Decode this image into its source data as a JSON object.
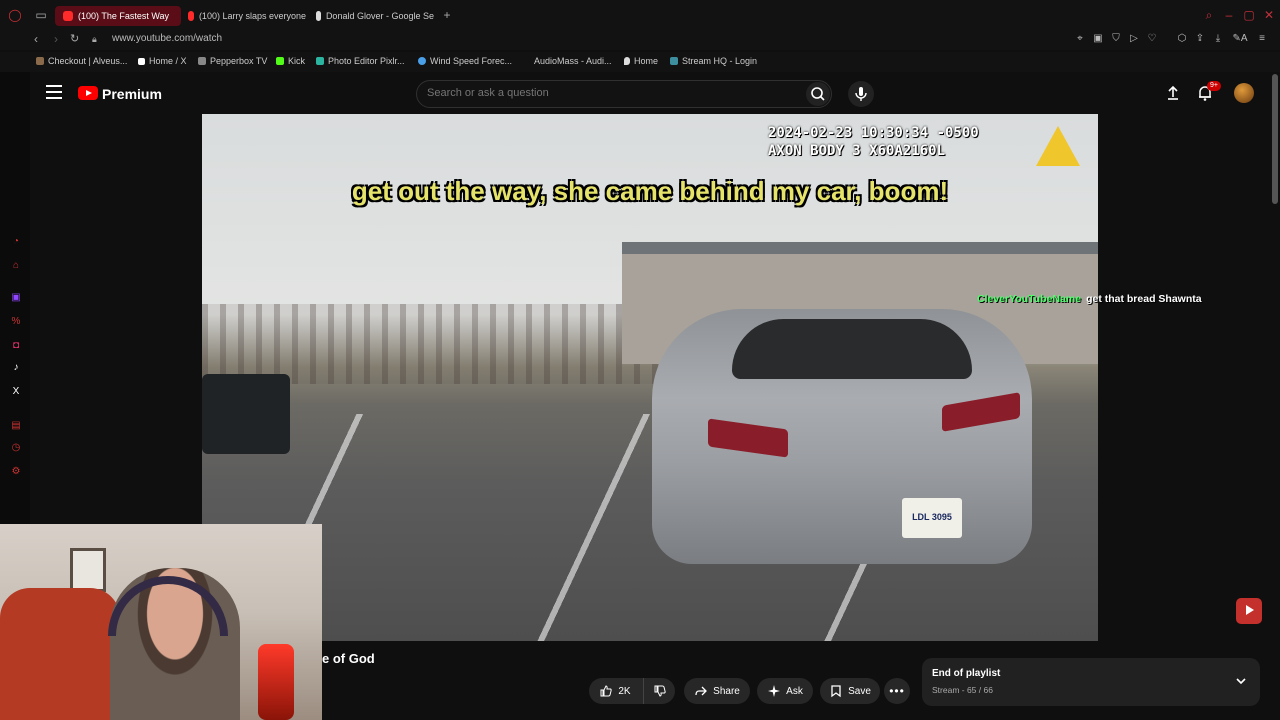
{
  "browser": {
    "tabs": [
      {
        "label": "(100) The Fastest Way",
        "active": true
      },
      {
        "label": "(100) Larry slaps everyone",
        "active": false
      },
      {
        "label": "Donald Glover - Google Se",
        "active": false
      }
    ],
    "url": "www.youtube.com/watch",
    "bookmarks": [
      "Checkout | Alveus...",
      "Home / X",
      "Pepperbox TV",
      "Kick",
      "Photo Editor Pixlr...",
      "Wind Speed Forec...",
      "AudioMass - Audi...",
      "Home",
      "Stream HQ - Login"
    ]
  },
  "youtube": {
    "brand": "Premium",
    "search_placeholder": "Search or ask a question",
    "notification_count": "9+"
  },
  "video": {
    "timestamp_line1": "2024-02-23 10:30:34 -0500",
    "timestamp_line2": "AXON BODY 3 X60A2160L",
    "caption": "get out the way, she came behind my car, boom!",
    "plate": "LDL 3095",
    "title_partial": "e of God"
  },
  "chat": {
    "username": "CleverYouTubeName",
    "message": "get that bread Shawnta"
  },
  "actions": {
    "like_count": "2K",
    "share": "Share",
    "ask": "Ask",
    "save": "Save"
  },
  "playlist": {
    "title": "End of playlist",
    "subtitle": "Stream - 65 / 66"
  },
  "colors": {
    "accent_red": "#ff0000",
    "chat_user": "#4cff6a",
    "caption_yellow": "#e6e36a"
  }
}
